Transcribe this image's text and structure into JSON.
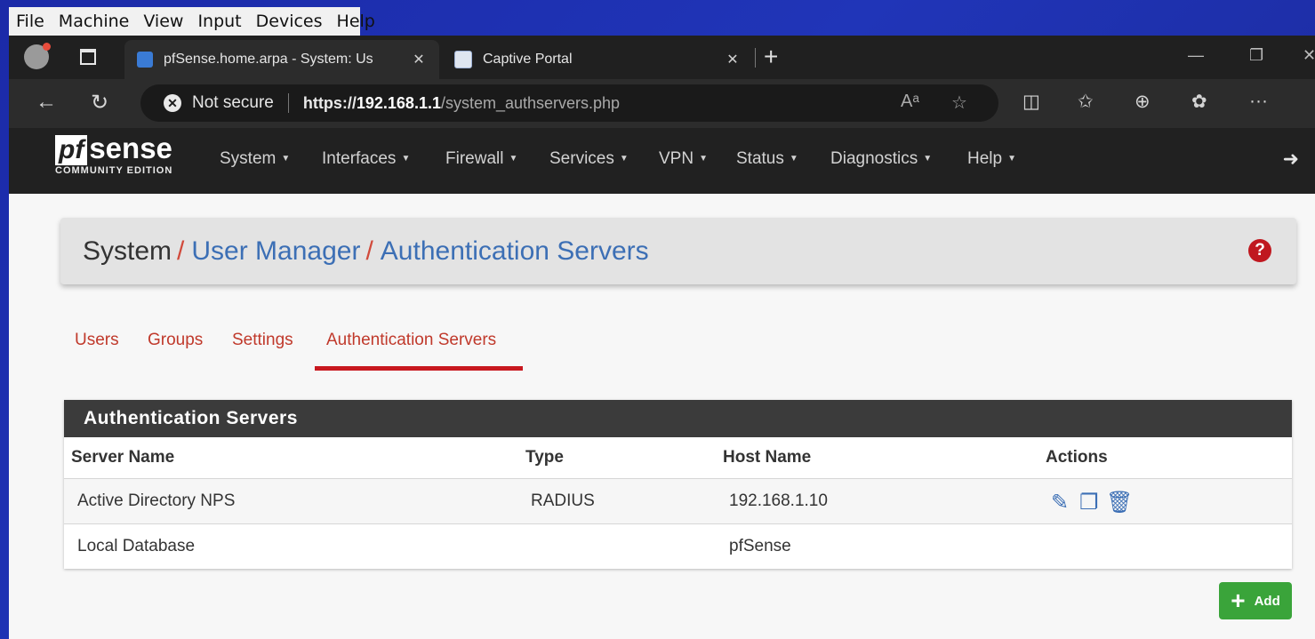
{
  "vm_menu": [
    "File",
    "Machine",
    "View",
    "Input",
    "Devices",
    "Help"
  ],
  "browser": {
    "tabs": [
      {
        "title": "pfSense.home.arpa - System: Us",
        "active": true
      },
      {
        "title": "Captive Portal",
        "active": false
      }
    ],
    "security_label": "Not secure",
    "url": {
      "scheme": "https://",
      "host": "192.168.1.1",
      "path": "/system_authservers.php"
    }
  },
  "pfsense": {
    "logo": {
      "box": "pf",
      "word": "sense",
      "sub": "COMMUNITY EDITION"
    },
    "nav": [
      "System",
      "Interfaces",
      "Firewall",
      "Services",
      "VPN",
      "Status",
      "Diagnostics",
      "Help"
    ]
  },
  "breadcrumb": {
    "root": "System",
    "items": [
      "User Manager",
      "Authentication Servers"
    ]
  },
  "subtabs": [
    {
      "label": "Users",
      "active": false
    },
    {
      "label": "Groups",
      "active": false
    },
    {
      "label": "Settings",
      "active": false
    },
    {
      "label": "Authentication Servers",
      "active": true
    }
  ],
  "panel": {
    "title": "Authentication Servers",
    "columns": [
      "Server Name",
      "Type",
      "Host Name",
      "Actions"
    ],
    "rows": [
      {
        "name": "Active Directory NPS",
        "type": "RADIUS",
        "host": "192.168.1.10",
        "actions": [
          "edit-icon",
          "copy-icon",
          "trash-icon"
        ]
      },
      {
        "name": "Local Database",
        "type": "",
        "host": "pfSense",
        "actions": []
      }
    ]
  },
  "add_button": {
    "label": "Add"
  },
  "colors": {
    "accent_red": "#c8181f",
    "link_blue": "#3c6fb5",
    "add_green": "#3aa43a",
    "nav_bg": "#212121"
  }
}
